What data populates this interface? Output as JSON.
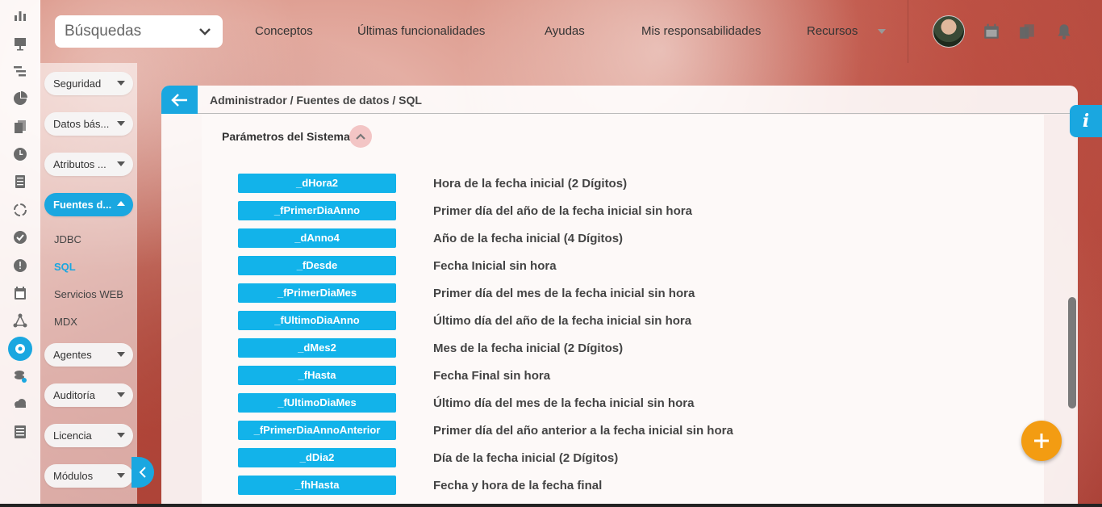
{
  "search": {
    "label": "Búsquedas"
  },
  "nav": {
    "items": [
      "Conceptos",
      "Últimas funcionalidades",
      "Ayudas",
      "Mis responsabilidades",
      "Recursos"
    ]
  },
  "rail": {
    "icons": [
      "bar-chart-icon",
      "presentation-icon",
      "gantt-icon",
      "pie-chart-icon",
      "documents-icon",
      "clock-icon",
      "list-icon",
      "cycle-icon",
      "check-circle-icon",
      "warning-icon",
      "calendar-icon",
      "network-icon",
      "gear-icon",
      "servers-icon",
      "cloud-icon",
      "list-alt-icon"
    ],
    "active_index": 12
  },
  "sidebar": {
    "items": [
      {
        "label": "Seguridad"
      },
      {
        "label": "Datos bás..."
      },
      {
        "label": "Atributos ..."
      },
      {
        "label": "Fuentes d..."
      },
      {
        "label": "Agentes"
      },
      {
        "label": "Auditoría"
      },
      {
        "label": "Licencia"
      },
      {
        "label": "Módulos"
      }
    ],
    "subitems": [
      "JDBC",
      "SQL",
      "Servicios WEB",
      "MDX"
    ],
    "active_sub": "SQL"
  },
  "breadcrumb": "Administrador / Fuentes de datos / SQL",
  "section": {
    "title": "Parámetros del Sistema"
  },
  "params": [
    {
      "name": "_dHora2",
      "desc": "Hora de la fecha inicial (2 Dígitos)"
    },
    {
      "name": "_fPrimerDiaAnno",
      "desc": "Primer día del año de la fecha inicial sin hora"
    },
    {
      "name": "_dAnno4",
      "desc": "Año de la fecha inicial (4 Dígitos)"
    },
    {
      "name": "_fDesde",
      "desc": "Fecha Inicial sin hora"
    },
    {
      "name": "_fPrimerDiaMes",
      "desc": "Primer día del mes de la fecha inicial sin hora"
    },
    {
      "name": "_fUltimoDiaAnno",
      "desc": "Último día del año de la fecha inicial sin hora"
    },
    {
      "name": "_dMes2",
      "desc": "Mes de la fecha inicial (2 Dígitos)"
    },
    {
      "name": "_fHasta",
      "desc": "Fecha Final sin hora"
    },
    {
      "name": "_fUltimoDiaMes",
      "desc": "Último día del mes de la fecha inicial sin hora"
    },
    {
      "name": "_fPrimerDiaAnnoAnterior",
      "desc": "Primer día del año anterior a la fecha inicial sin hora"
    },
    {
      "name": "_dDia2",
      "desc": "Día de la fecha inicial (2 Dígitos)"
    },
    {
      "name": "_fhHasta",
      "desc": "Fecha y hora de la fecha final"
    }
  ],
  "colors": {
    "accent": "#1aa7e0",
    "param": "#12b3ea",
    "fab": "#f39c12"
  },
  "info_label": "i"
}
